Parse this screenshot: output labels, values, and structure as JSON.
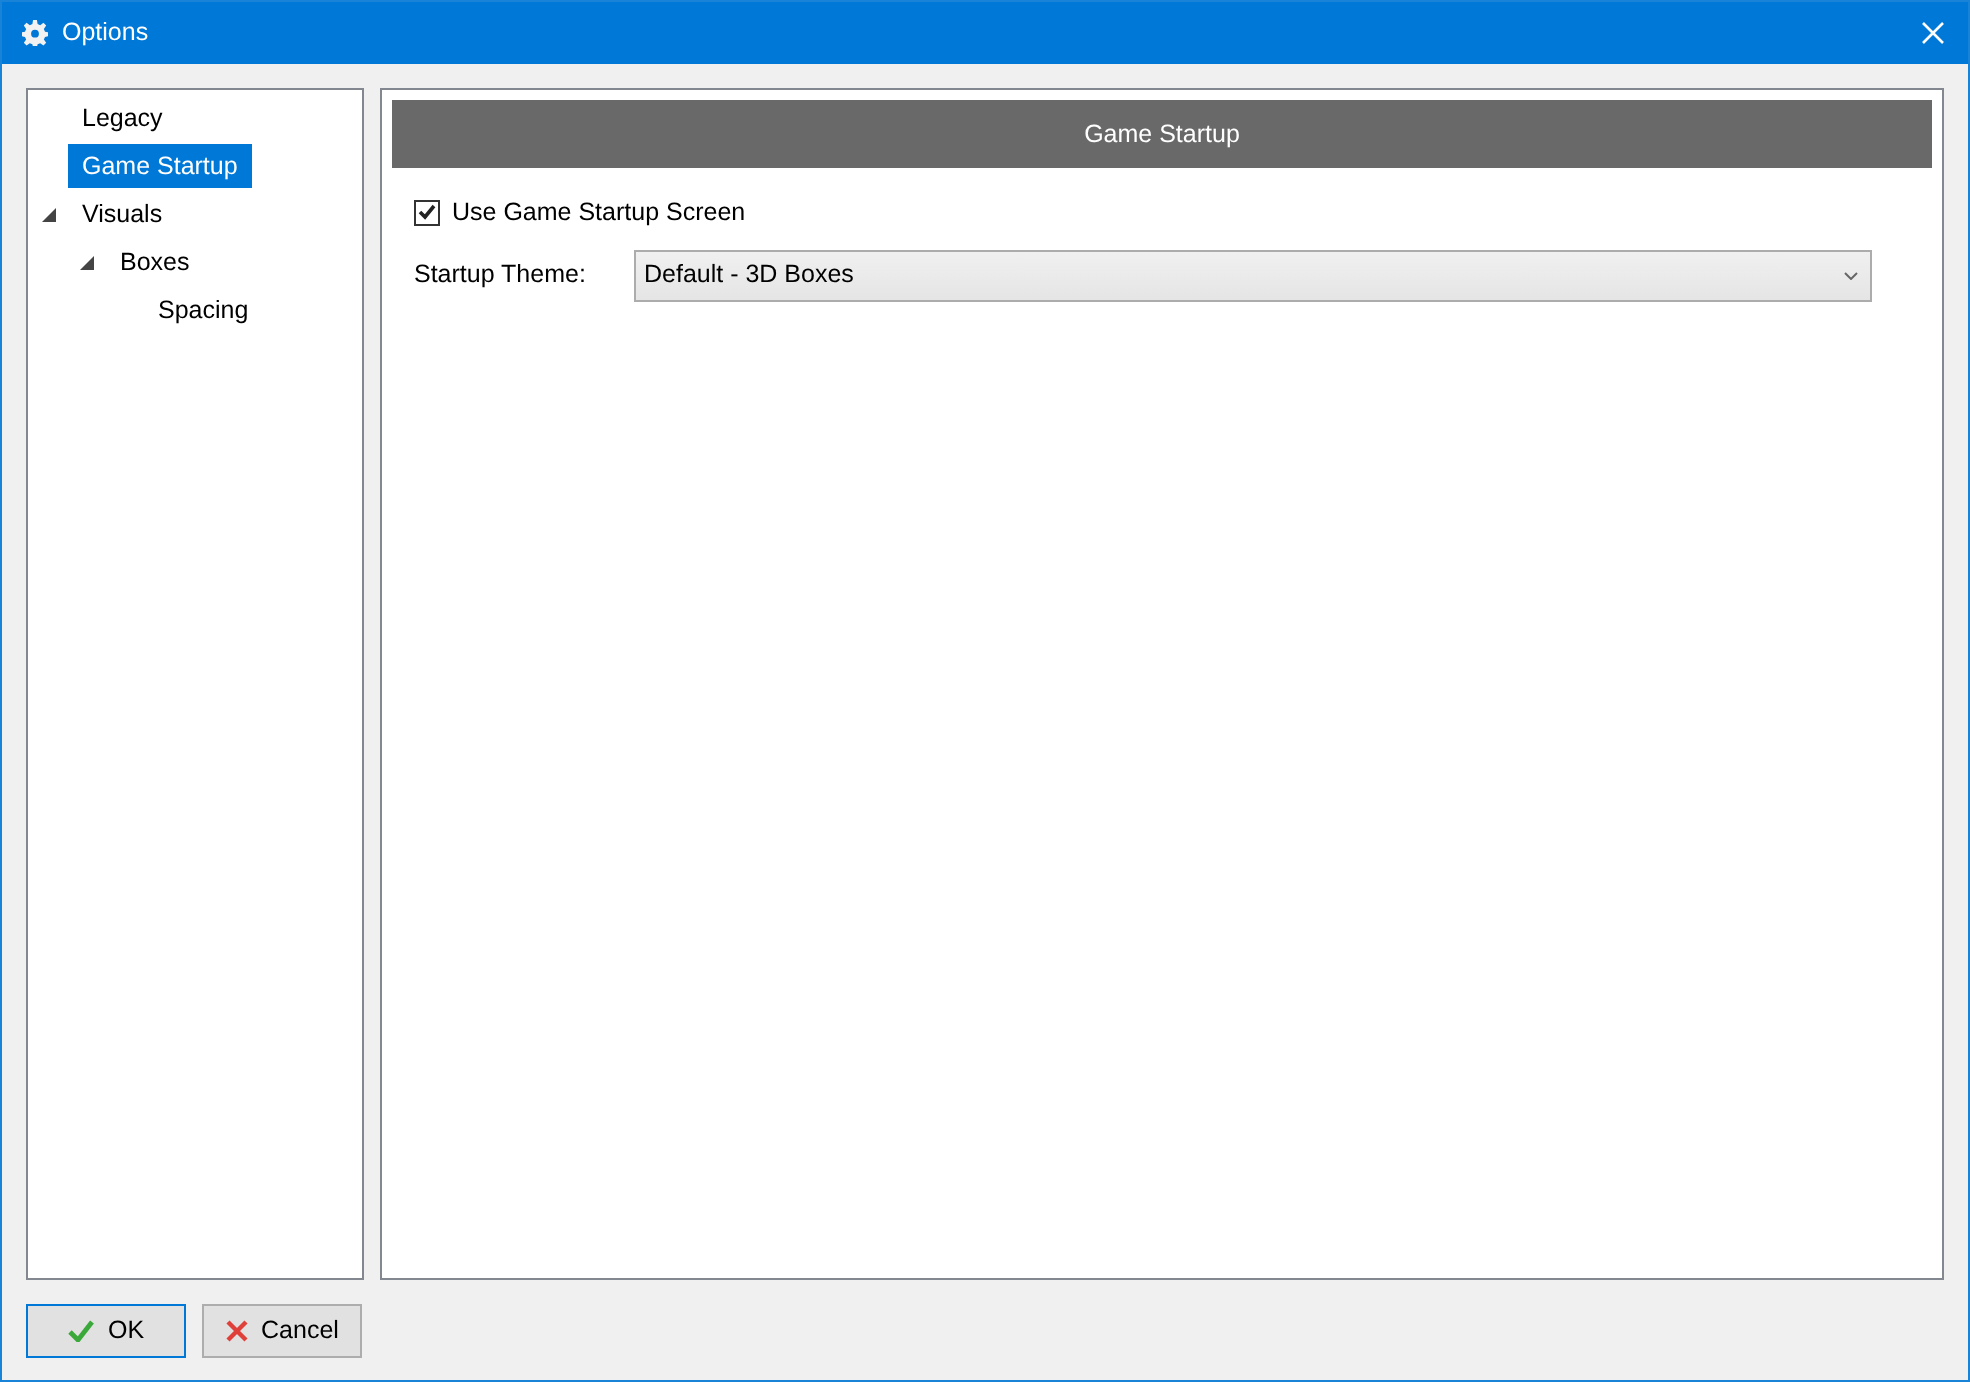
{
  "window": {
    "title": "Options"
  },
  "tree": [
    {
      "label": "Legacy",
      "selected": false
    },
    {
      "label": "Game Startup",
      "selected": true
    },
    {
      "label": "Visuals",
      "selected": false,
      "expanded": true,
      "children": [
        {
          "label": "Boxes",
          "selected": false,
          "expanded": true,
          "children": [
            {
              "label": "Spacing",
              "selected": false
            }
          ]
        }
      ]
    }
  ],
  "panel": {
    "header": "Game Startup",
    "checkbox": {
      "label": "Use Game Startup Screen",
      "checked": true
    },
    "theme": {
      "label": "Startup Theme:",
      "value": "Default - 3D Boxes"
    }
  },
  "buttons": [
    {
      "kind": "ok",
      "label": "OK"
    },
    {
      "kind": "cancel",
      "label": "Cancel"
    }
  ]
}
